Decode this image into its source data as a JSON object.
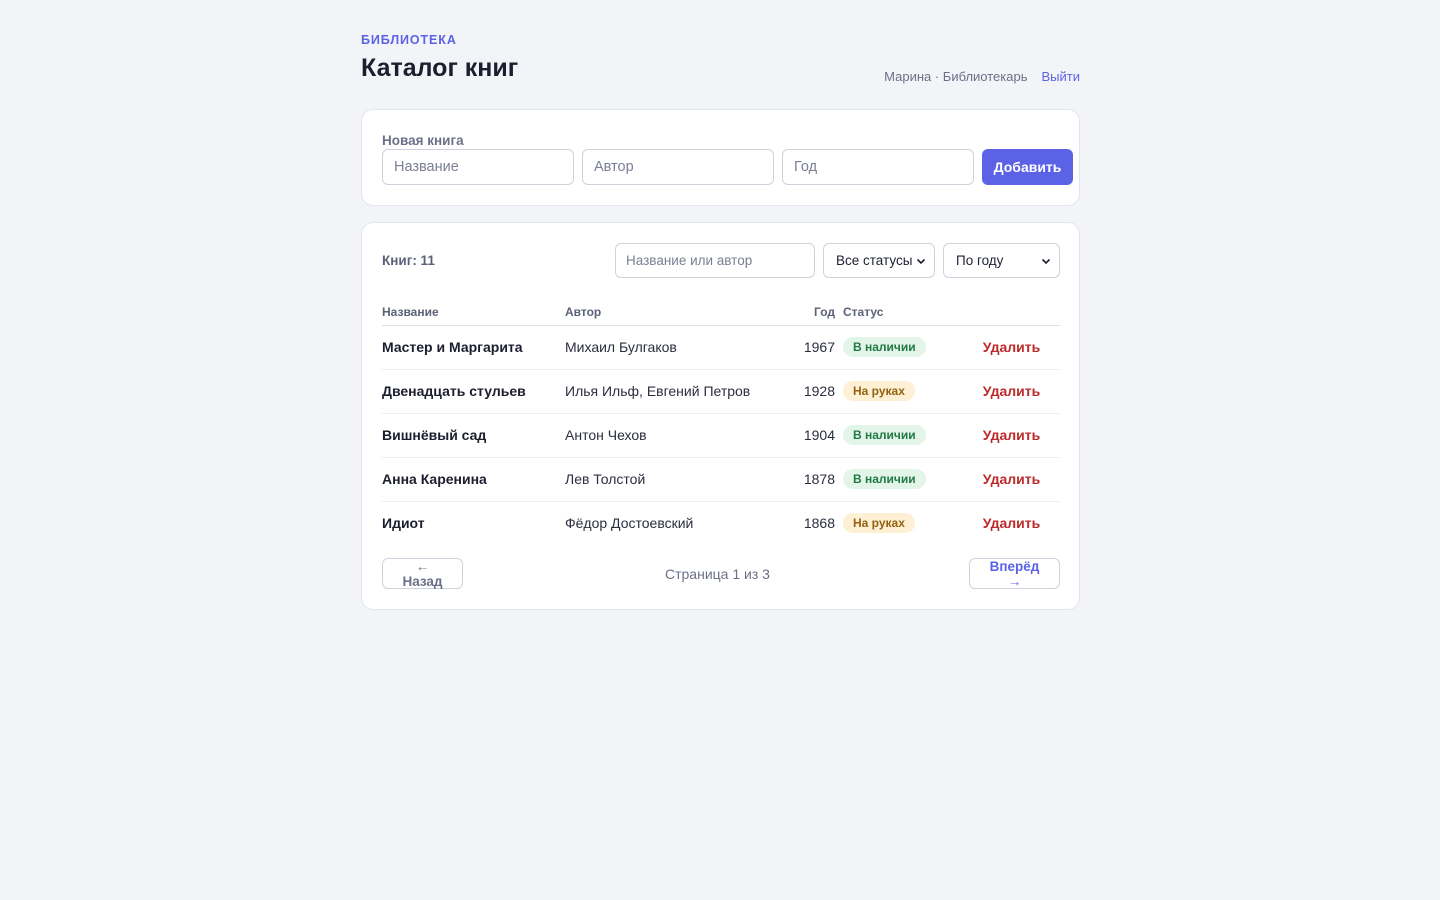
{
  "header": {
    "eyebrow": "БИБЛИОТЕКА",
    "title": "Каталог книг",
    "user": "Марина · Библиотекарь",
    "logout": "Выйти"
  },
  "new_book": {
    "label": "Новая книга",
    "title_placeholder": "Название",
    "author_placeholder": "Автор",
    "year_placeholder": "Год",
    "add_label": "Добавить"
  },
  "list": {
    "count": "Книг: 11",
    "search_placeholder": "Название или автор",
    "status_filter": "Все статусы",
    "sort": "По году",
    "columns": [
      "Название",
      "Автор",
      "Год",
      "Статус"
    ],
    "delete_label": "Удалить",
    "rows": [
      {
        "title": "Мастер и Маргарита",
        "author": "Михаил Булгаков",
        "year": "1967",
        "status": "В наличии",
        "status_kind": "available"
      },
      {
        "title": "Двенадцать стульев",
        "author": "Илья Ильф, Евгений Петров",
        "year": "1928",
        "status": "На руках",
        "status_kind": "onloan"
      },
      {
        "title": "Вишнёвый сад",
        "author": "Антон Чехов",
        "year": "1904",
        "status": "В наличии",
        "status_kind": "available"
      },
      {
        "title": "Анна Каренина",
        "author": "Лев Толстой",
        "year": "1878",
        "status": "В наличии",
        "status_kind": "available"
      },
      {
        "title": "Идиот",
        "author": "Фёдор Достоевский",
        "year": "1868",
        "status": "На руках",
        "status_kind": "onloan"
      }
    ]
  },
  "pagination": {
    "prev": "← Назад",
    "info": "Страница 1 из 3",
    "next": "Вперёд →"
  },
  "colors": {
    "accent": "#5b62e6",
    "danger": "#bd2a2a",
    "available_bg": "#e3f5e9",
    "onloan_bg": "#fdf0d5",
    "background": "#f3f4f8"
  },
  "icons": {
    "select_chevron": "chevron-down-icon"
  }
}
